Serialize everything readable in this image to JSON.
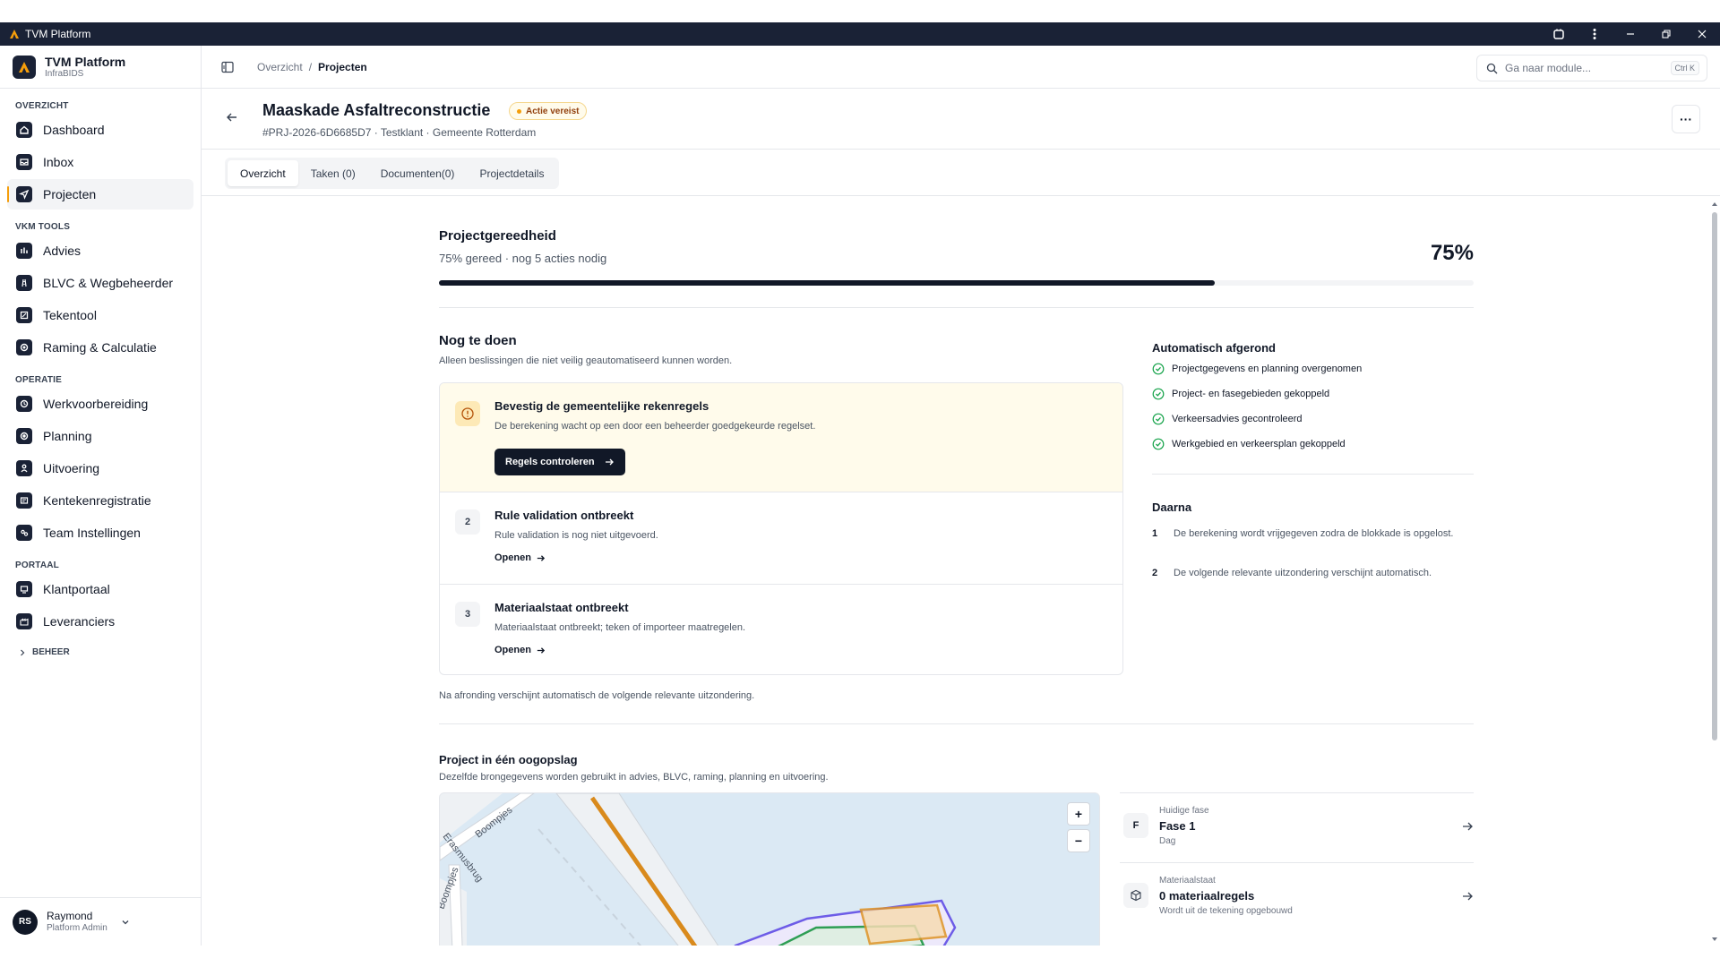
{
  "window": {
    "title": "TVM Platform"
  },
  "brand": {
    "name": "TVM Platform",
    "sub": "InfraBIDS"
  },
  "sidebar": {
    "sections": [
      {
        "label": "OVERZICHT",
        "items": [
          {
            "label": "Dashboard",
            "icon": "home-icon"
          },
          {
            "label": "Inbox",
            "icon": "inbox-icon"
          },
          {
            "label": "Projecten",
            "icon": "send-icon",
            "active": true
          }
        ]
      },
      {
        "label": "VKM TOOLS",
        "items": [
          {
            "label": "Advies",
            "icon": "advice-icon"
          },
          {
            "label": "BLVC & Wegbeheerder",
            "icon": "road-icon"
          },
          {
            "label": "Tekentool",
            "icon": "pencil-icon"
          },
          {
            "label": "Raming & Calculatie",
            "icon": "calculator-icon"
          }
        ]
      },
      {
        "label": "OPERATIE",
        "items": [
          {
            "label": "Werkvoorbereiding",
            "icon": "clipboard-icon"
          },
          {
            "label": "Planning",
            "icon": "calendar-icon"
          },
          {
            "label": "Uitvoering",
            "icon": "worker-icon"
          },
          {
            "label": "Kentekenregistratie",
            "icon": "car-icon"
          },
          {
            "label": "Team Instellingen",
            "icon": "team-icon"
          }
        ]
      },
      {
        "label": "PORTAAL",
        "items": [
          {
            "label": "Klantportaal",
            "icon": "portal-icon"
          },
          {
            "label": "Leveranciers",
            "icon": "supplier-icon"
          }
        ]
      }
    ],
    "collapsed_section": "BEHEER"
  },
  "user": {
    "initials": "RS",
    "name": "Raymond",
    "role": "Platform Admin"
  },
  "topbar": {
    "breadcrumb": [
      "Overzicht",
      "Projecten"
    ],
    "search_placeholder": "Ga naar module...",
    "search_shortcut": "Ctrl K"
  },
  "project": {
    "title": "Maaskade Asfaltreconstructie",
    "badge": "Actie vereist",
    "meta": "#PRJ-2026-6D6685D7 · Testklant · Gemeente Rotterdam",
    "more_label": "···"
  },
  "tabs": [
    {
      "label": "Overzicht",
      "active": true
    },
    {
      "label": "Taken (0)"
    },
    {
      "label": "Documenten(0)"
    },
    {
      "label": "Projectdetails"
    }
  ],
  "readiness": {
    "title": "Projectgereedheid",
    "subtitle": "75% gereed · nog 5 acties nodig",
    "percent_label": "75%",
    "progress": 0.75
  },
  "todo": {
    "title": "Nog te doen",
    "subtitle": "Alleen beslissingen die niet veilig geautomatiseerd kunnen worden.",
    "items": [
      {
        "title": "Bevestig de gemeentelijke rekenregels",
        "desc": "De berekening wacht op een door een beheerder goedgekeurde regelset.",
        "action": "Regels controleren"
      },
      {
        "num": "2",
        "title": "Rule validation ontbreekt",
        "desc": "Rule validation is nog niet uitgevoerd.",
        "action": "Openen"
      },
      {
        "num": "3",
        "title": "Materiaalstaat ontbreekt",
        "desc": "Materiaalstaat ontbreekt; teken of importeer maatregelen.",
        "action": "Openen"
      }
    ],
    "after_note": "Na afronding verschijnt automatisch de volgende relevante uitzondering."
  },
  "auto_done": {
    "title": "Automatisch afgerond",
    "items": [
      "Projectgegevens en planning overgenomen",
      "Project- en fasegebieden gekoppeld",
      "Verkeersadvies gecontroleerd",
      "Werkgebied en verkeersplan gekoppeld"
    ]
  },
  "then": {
    "title": "Daarna",
    "items": [
      {
        "num": "1",
        "text": "De berekening wordt vrijgegeven zodra de blokkade is opgelost."
      },
      {
        "num": "2",
        "text": "De volgende relevante uitzondering verschijnt automatisch."
      }
    ]
  },
  "glance": {
    "title": "Project in één oogopslag",
    "subtitle": "Dezelfde brongegevens worden gebruikt in advies, BLVC, raming, planning en uitvoering.",
    "map": {
      "street_labels": [
        "Boompjes",
        "Boompjes",
        "Erasmusbrug"
      ],
      "zoom_in": "+",
      "zoom_out": "−"
    },
    "cards": [
      {
        "icon_letter": "F",
        "label": "Huidige fase",
        "value": "Fase 1",
        "sub": "Dag"
      },
      {
        "label": "Materiaalstaat",
        "value": "0 materiaalregels",
        "sub": "Wordt uit de tekening opgebouwd",
        "icon": "box-icon"
      }
    ]
  },
  "colors": {
    "navy": "#1a2236",
    "accent_amber": "#f59e0b",
    "success_green": "#16a34a"
  }
}
